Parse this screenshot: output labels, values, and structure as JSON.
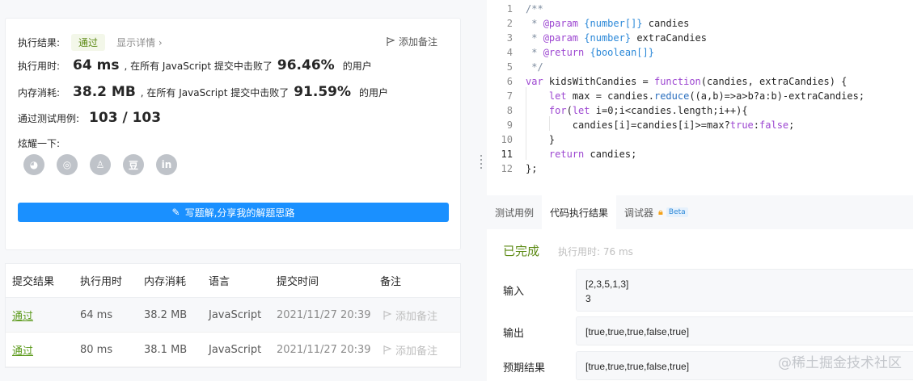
{
  "result": {
    "status_label": "执行结果:",
    "status": "通过",
    "details_link": "显示详情 ›",
    "add_note": "添加备注",
    "runtime_label": "执行用时:",
    "runtime": "64 ms",
    "runtime_mid": ", 在所有 JavaScript 提交中击败了",
    "runtime_pct": "96.46%",
    "runtime_tail": "的用户",
    "memory_label": "内存消耗:",
    "memory": "38.2 MB",
    "memory_mid": ", 在所有 JavaScript 提交中击败了",
    "memory_pct": "91.59%",
    "memory_tail": "的用户",
    "tests_label": "通过测试用例:",
    "tests": "103 / 103",
    "share_label": "炫耀一下:",
    "share_icons": [
      "wechat-icon",
      "weibo-icon",
      "qq-icon",
      "douban-icon",
      "linkedin-icon"
    ],
    "share_glyphs": [
      "◕",
      "◎",
      "♙",
      "豆",
      "in"
    ],
    "write_solution": "写题解,分享我的解题思路"
  },
  "submissions": {
    "headers": [
      "提交结果",
      "执行用时",
      "内存消耗",
      "语言",
      "提交时间",
      "备注"
    ],
    "rows": [
      {
        "result": "通过",
        "time": "64 ms",
        "memory": "38.2 MB",
        "lang": "JavaScript",
        "submitted": "2021/11/27 20:39",
        "note": "添加备注"
      },
      {
        "result": "通过",
        "time": "80 ms",
        "memory": "38.1 MB",
        "lang": "JavaScript",
        "submitted": "2021/11/27 20:39",
        "note": "添加备注"
      }
    ]
  },
  "editor": {
    "line_numbers": [
      "1",
      "2",
      "3",
      "4",
      "5",
      "6",
      "7",
      "8",
      "9",
      "10",
      "11",
      "12"
    ]
  },
  "tabs": {
    "testcase": "测试用例",
    "result": "代码执行结果",
    "debugger": "调试器",
    "beta": "Beta"
  },
  "run": {
    "status": "已完成",
    "elapsed": "执行用时: 76 ms",
    "input_label": "输入",
    "input_line1": "[2,3,5,1,3]",
    "input_line2": "3",
    "output_label": "输出",
    "output": "[true,true,true,false,true]",
    "expected_label": "预期结果",
    "expected": "[true,true,true,false,true]"
  },
  "watermark": "@稀土掘金技术社区",
  "colors": {
    "pass": "#5c9a1c",
    "accent": "#1a90ff"
  }
}
